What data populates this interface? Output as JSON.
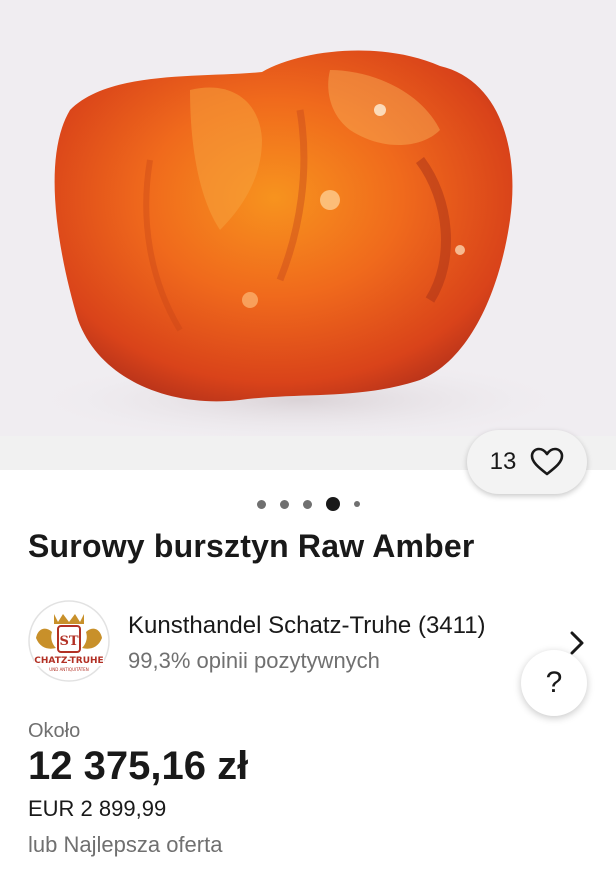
{
  "gallery": {
    "image_alt": "Surowy bursztyn Raw Amber",
    "like_count": "13",
    "page_dots": 5,
    "active_dot_index": 3
  },
  "listing": {
    "title": "Surowy bursztyn Raw Amber"
  },
  "seller": {
    "name": "Kunsthandel Schatz-Truhe (3411)",
    "feedback": "99,3% opinii pozytywnych",
    "logo_monogram": "ST",
    "logo_text": "CHATZ-TRUHE",
    "logo_subtext": "UND ANTIQUITÄTEN"
  },
  "help": {
    "label": "?"
  },
  "price": {
    "approx_label": "Około",
    "converted": "12 375,16 zł",
    "original": "EUR 2 899,99",
    "best_offer": "lub Najlepsza oferta"
  },
  "colors": {
    "text_primary": "#191919",
    "text_secondary": "#707070",
    "amber": "#e8561a"
  }
}
